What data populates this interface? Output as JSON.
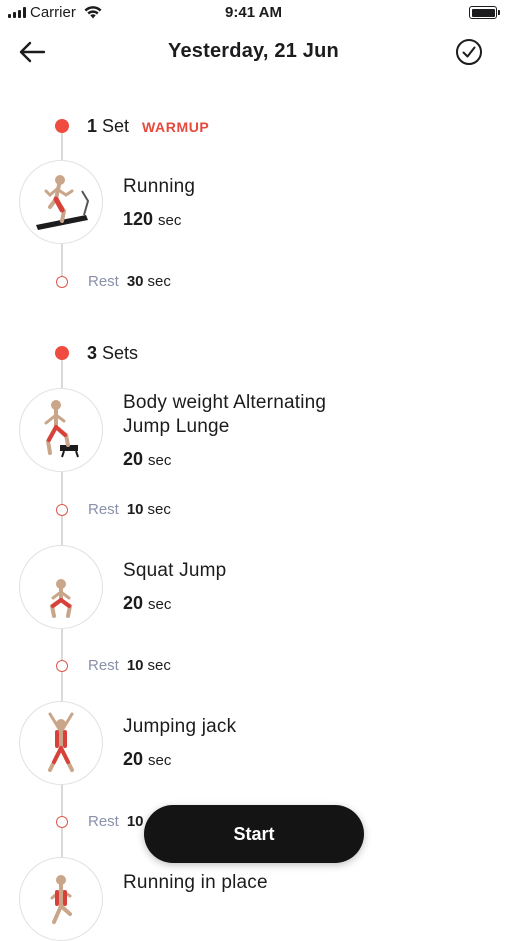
{
  "status_bar": {
    "carrier": "Carrier",
    "time": "9:41 AM"
  },
  "header": {
    "title": "Yesterday, 21 Jun"
  },
  "colors": {
    "accent": "#ef4b3f",
    "rest_label": "#8a90a8",
    "button_bg": "#141414"
  },
  "blocks": [
    {
      "count": "1",
      "sets_word": "Set",
      "tag": "WARMUP"
    },
    {
      "count": "3",
      "sets_word": "Sets",
      "tag": ""
    }
  ],
  "exercises": [
    {
      "name": "Running",
      "duration": "120",
      "unit": "sec",
      "icon": "running-treadmill-icon"
    },
    {
      "name": "Body weight Alternating Jump Lunge",
      "name_line1": "Body weight Alternating",
      "name_line2": "Jump Lunge",
      "duration": "20",
      "unit": "sec",
      "icon": "jump-lunge-icon"
    },
    {
      "name": "Squat Jump",
      "duration": "20",
      "unit": "sec",
      "icon": "squat-jump-icon"
    },
    {
      "name": "Jumping jack",
      "duration": "20",
      "unit": "sec",
      "icon": "jumping-jack-icon"
    },
    {
      "name": "Running in place",
      "duration": "",
      "unit": "",
      "icon": "running-in-place-icon"
    }
  ],
  "rests": [
    {
      "label": "Rest",
      "value": "30",
      "unit": "sec"
    },
    {
      "label": "Rest",
      "value": "10",
      "unit": "sec"
    },
    {
      "label": "Rest",
      "value": "10",
      "unit": "sec"
    },
    {
      "label": "Rest",
      "value": "10",
      "unit": ""
    }
  ],
  "start_button": {
    "label": "Start"
  }
}
